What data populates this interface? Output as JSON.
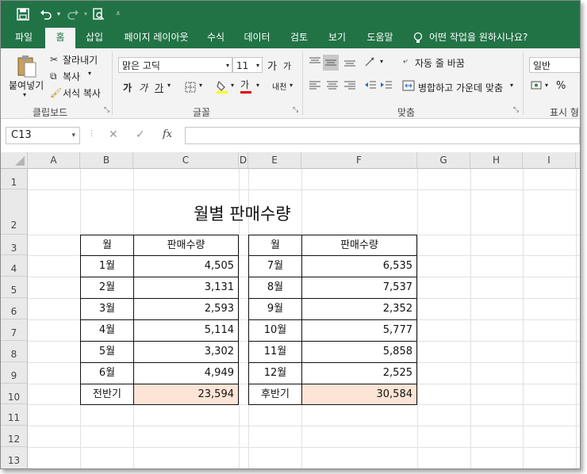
{
  "qat": {
    "save_icon": "save-icon",
    "undo_icon": "undo-icon",
    "redo_icon": "redo-icon",
    "preview_icon": "print-preview-icon",
    "customize_icon": "customize-icon"
  },
  "tabs": [
    "파일",
    "홈",
    "삽입",
    "페이지 레이아웃",
    "수식",
    "데이터",
    "검토",
    "보기",
    "도움말"
  ],
  "active_tab": "홈",
  "tell_me": "어떤 작업을 원하시나요?",
  "ribbon": {
    "clipboard": {
      "paste": "붙여넣기",
      "cut": "잘라내기",
      "copy": "복사",
      "format_painter": "서식 복사",
      "group_label": "클립보드"
    },
    "font": {
      "font_name": "맑은 고딕",
      "font_size": "11",
      "group_label": "글꼴",
      "bold": "가",
      "italic": "가",
      "underline": "가",
      "font_color_glyph": "가",
      "grow": "가",
      "shrink": "가",
      "phonetic": "내천"
    },
    "alignment": {
      "wrap_text": "자동 줄 바꿈",
      "merge_center": "병합하고 가운데 맞춤",
      "group_label": "맞춤"
    },
    "number": {
      "format": "일반",
      "group_label": "표시 형",
      "percent": "%"
    }
  },
  "formula_bar": {
    "name_box": "C13",
    "cancel": "✕",
    "enter": "✓",
    "fx": "fx",
    "value": ""
  },
  "columns": [
    "A",
    "B",
    "C",
    "D",
    "E",
    "F",
    "G",
    "H",
    "I"
  ],
  "rows": [
    "1",
    "2",
    "3",
    "4",
    "5",
    "6",
    "7",
    "8",
    "9",
    "10",
    "11",
    "12",
    "13"
  ],
  "sheet": {
    "title": "월별 판매수량",
    "left_table": {
      "header": [
        "월",
        "판매수량"
      ],
      "rows": [
        [
          "1월",
          "4,505"
        ],
        [
          "2월",
          "3,131"
        ],
        [
          "3월",
          "2,593"
        ],
        [
          "4월",
          "5,114"
        ],
        [
          "5월",
          "3,302"
        ],
        [
          "6월",
          "4,949"
        ]
      ],
      "total": [
        "전반기",
        "23,594"
      ]
    },
    "right_table": {
      "header": [
        "월",
        "판매수량"
      ],
      "rows": [
        [
          "7월",
          "6,535"
        ],
        [
          "8월",
          "7,537"
        ],
        [
          "9월",
          "2,352"
        ],
        [
          "10월",
          "5,777"
        ],
        [
          "11월",
          "5,858"
        ],
        [
          "12월",
          "2,525"
        ]
      ],
      "total": [
        "후반기",
        "30,584"
      ]
    }
  },
  "colors": {
    "excel_green": "#217346",
    "total_fill": "#fce4d6"
  }
}
